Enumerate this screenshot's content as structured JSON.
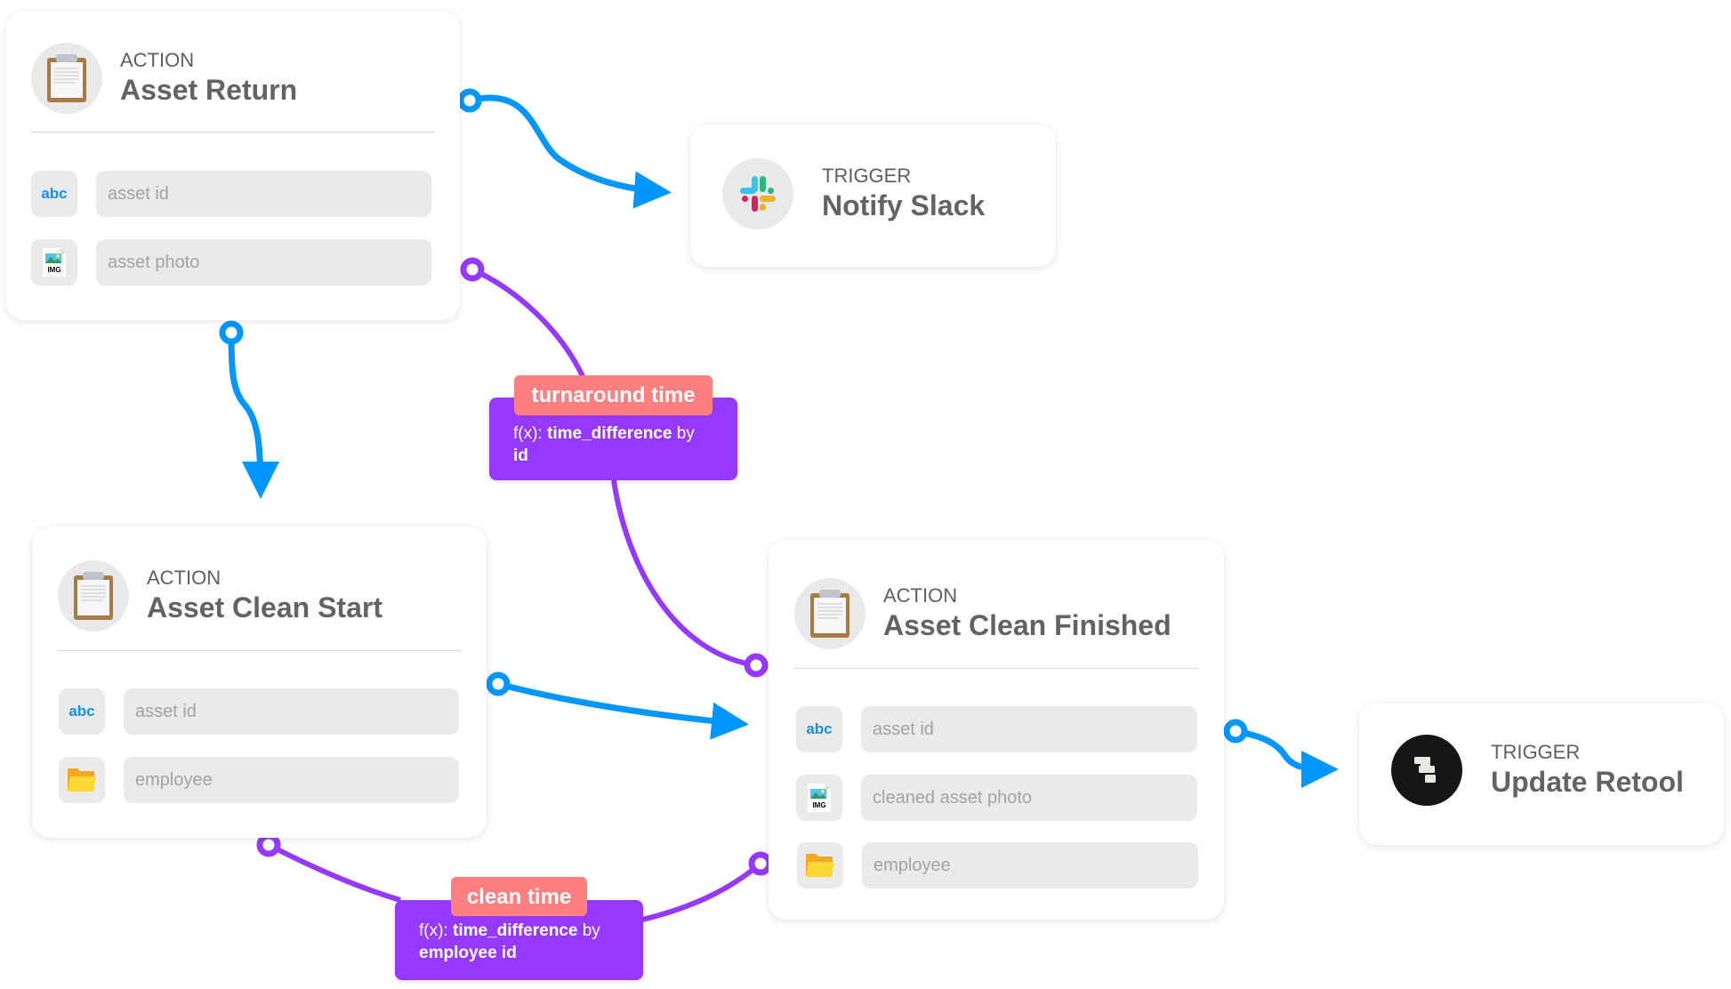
{
  "colors": {
    "flow": "#0096ff",
    "calc": "#9639fe",
    "calc_label": "#fe7f7f"
  },
  "nodes": {
    "asset_return": {
      "kind": "ACTION",
      "title": "Asset Return",
      "icon": "clipboard-icon",
      "fields": [
        {
          "type": "abc",
          "type_icon": "text-type-icon",
          "label": "asset id"
        },
        {
          "type": "IMG",
          "type_icon": "image-type-icon",
          "label": "asset photo"
        }
      ]
    },
    "notify_slack": {
      "kind": "TRIGGER",
      "title": "Notify Slack",
      "icon": "slack-icon"
    },
    "asset_clean_start": {
      "kind": "ACTION",
      "title": "Asset Clean Start",
      "icon": "clipboard-icon",
      "fields": [
        {
          "type": "abc",
          "type_icon": "text-type-icon",
          "label": "asset id"
        },
        {
          "type": "folder",
          "type_icon": "folder-icon",
          "label": "employee"
        }
      ]
    },
    "asset_clean_finished": {
      "kind": "ACTION",
      "title": "Asset Clean Finished",
      "icon": "clipboard-icon",
      "fields": [
        {
          "type": "abc",
          "type_icon": "text-type-icon",
          "label": "asset id"
        },
        {
          "type": "IMG",
          "type_icon": "image-type-icon",
          "label": "cleaned asset photo"
        },
        {
          "type": "folder",
          "type_icon": "folder-icon",
          "label": "employee"
        }
      ]
    },
    "update_retool": {
      "kind": "TRIGGER",
      "title": "Update Retool",
      "icon": "retool-icon"
    }
  },
  "calculations": {
    "turnaround": {
      "label": "turnaround time",
      "fx_prefix": "f(x): ",
      "function": "time_difference",
      "by_word": " by",
      "key": "id"
    },
    "clean": {
      "label": "clean time",
      "fx_prefix": "f(x): ",
      "function": "time_difference",
      "by_word": " by",
      "key": "employee id"
    }
  },
  "edges": [
    {
      "from": "Asset Return",
      "to": "Notify Slack",
      "kind": "flow"
    },
    {
      "from": "Asset Return",
      "to": "Asset Clean Start",
      "kind": "flow"
    },
    {
      "from": "Asset Clean Start",
      "to": "Asset Clean Finished",
      "kind": "flow"
    },
    {
      "from": "Asset Clean Finished",
      "to": "Update Retool",
      "kind": "flow"
    },
    {
      "from": "Asset Return",
      "to": "Asset Clean Finished",
      "kind": "calc",
      "label": "turnaround time"
    },
    {
      "from": "Asset Clean Start",
      "to": "Asset Clean Finished",
      "kind": "calc",
      "label": "clean time"
    }
  ]
}
